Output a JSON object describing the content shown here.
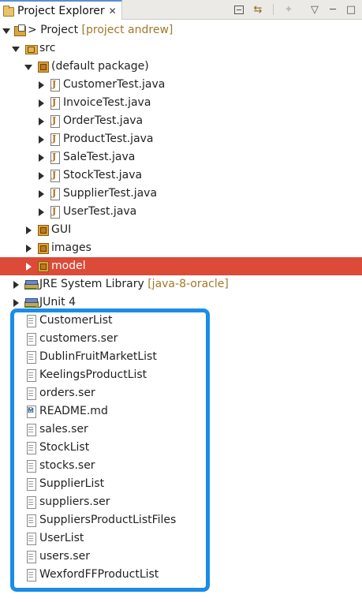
{
  "tab": {
    "title": "Project Explorer",
    "close": "✕",
    "icon": "folder-icon"
  },
  "toolbar": {
    "collapse_all": "collapse-all-icon",
    "link_with_editor_glyph": "⇆",
    "focus_glyph": "✦",
    "view_menu_glyph": "▽",
    "minimize_glyph": "─",
    "maximize_glyph": "□"
  },
  "tree": {
    "project": {
      "prefix": ">",
      "name": "Project",
      "decoration": "[project andrew]"
    },
    "src": "src",
    "default_package": "(default package)",
    "java_files": [
      "CustomerTest.java",
      "InvoiceTest.java",
      "OrderTest.java",
      "ProductTest.java",
      "SaleTest.java",
      "StockTest.java",
      "SupplierTest.java",
      "UserTest.java"
    ],
    "packages": [
      "GUI",
      "images",
      "model"
    ],
    "jre": {
      "name": "JRE System Library",
      "decoration": "[java-8-oracle]"
    },
    "junit": "JUnit 4",
    "files": [
      "CustomerList",
      "customers.ser",
      "DublinFruitMarketList",
      "KeelingsProductList",
      "orders.ser",
      "README.md",
      "sales.ser",
      "StockList",
      "stocks.ser",
      "SupplierList",
      "suppliers.ser",
      "SuppliersProductListFiles",
      "UserList",
      "users.ser",
      "WexfordFFProductList"
    ]
  },
  "colors": {
    "selection": "#dc4a38",
    "highlight_box": "#1a8de6",
    "decoration": "#a0782a"
  }
}
